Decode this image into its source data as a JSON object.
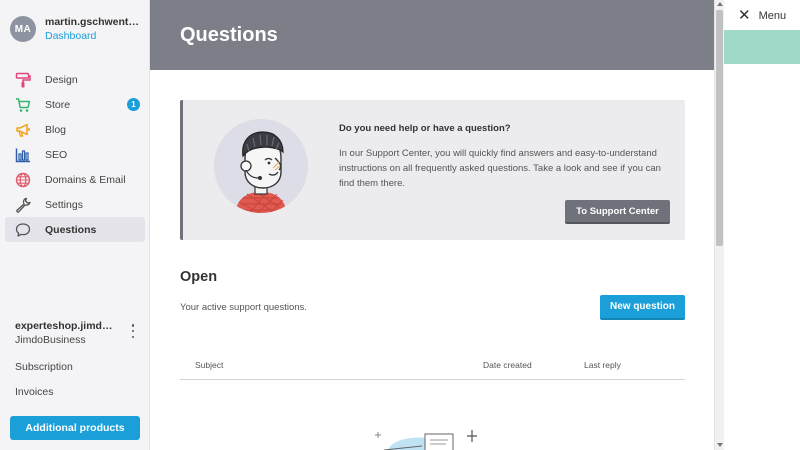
{
  "user": {
    "initials": "MA",
    "name": "martin.gschwentner…",
    "dashboard_link": "Dashboard"
  },
  "nav": {
    "items": [
      {
        "label": "Design",
        "icon": "paint-roller-icon"
      },
      {
        "label": "Store",
        "icon": "cart-icon",
        "badge": "1"
      },
      {
        "label": "Blog",
        "icon": "megaphone-icon"
      },
      {
        "label": "SEO",
        "icon": "bar-chart-icon"
      },
      {
        "label": "Domains & Email",
        "icon": "globe-icon"
      },
      {
        "label": "Settings",
        "icon": "wrench-icon"
      },
      {
        "label": "Questions",
        "icon": "speech-bubble-icon",
        "active": true
      }
    ]
  },
  "site": {
    "name": "experteshop.jimdofre…",
    "plan": "JimdoBusiness"
  },
  "links": {
    "subscription": "Subscription",
    "invoices": "Invoices"
  },
  "additional_products": "Additional products",
  "page": {
    "title": "Questions"
  },
  "help": {
    "title": "Do you need help or have a question?",
    "text": "In our Support Center, you will quickly find answers and easy-to-understand instructions on all frequently asked questions. Take a look and see if you can find them there.",
    "button": "To Support Center"
  },
  "open": {
    "title": "Open",
    "subtitle": "Your active support questions.",
    "new_button": "New question",
    "columns": {
      "subject": "Subject",
      "date": "Date created",
      "reply": "Last reply"
    }
  },
  "menu": {
    "label": "Menu"
  },
  "colors": {
    "accent": "#1a9fd9",
    "header": "#7c7f87",
    "sidebar": "#f4f4f6",
    "menu_strip": "#a0d9c9"
  }
}
